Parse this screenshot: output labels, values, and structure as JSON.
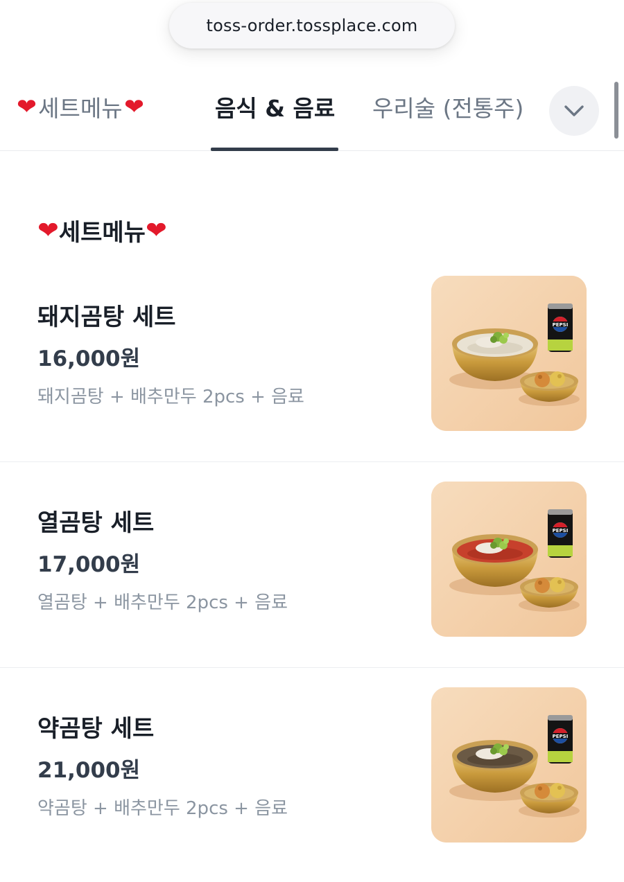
{
  "browser": {
    "url": "toss-order.tossplace.com"
  },
  "tabs": [
    {
      "label": "세트메뉴",
      "active": false
    },
    {
      "label": "음식 & 음료",
      "active": true
    },
    {
      "label": "우리술 (전통주)",
      "active": false
    }
  ],
  "section": {
    "title": "세트메뉴"
  },
  "items": [
    {
      "name": "돼지곰탕 세트",
      "price": "16,000원",
      "description": "돼지곰탕 + 배추만두 2pcs + 음료",
      "soup": "clear"
    },
    {
      "name": "열곰탕 세트",
      "price": "17,000원",
      "description": "열곰탕 + 배추만두 2pcs + 음료",
      "soup": "red"
    },
    {
      "name": "약곰탕 세트",
      "price": "21,000원",
      "description": "약곰탕 + 배추만두 2pcs + 음료",
      "soup": "dark"
    }
  ],
  "can_label": "PEPSI",
  "icons": {
    "heart": "heart-emoji-icon",
    "more": "chevron-down-icon"
  },
  "colors": {
    "accent_text": "#191f28",
    "muted_text": "#8b95a1",
    "heart": "#e3192b",
    "photo_bg": "#f5d0a9"
  }
}
